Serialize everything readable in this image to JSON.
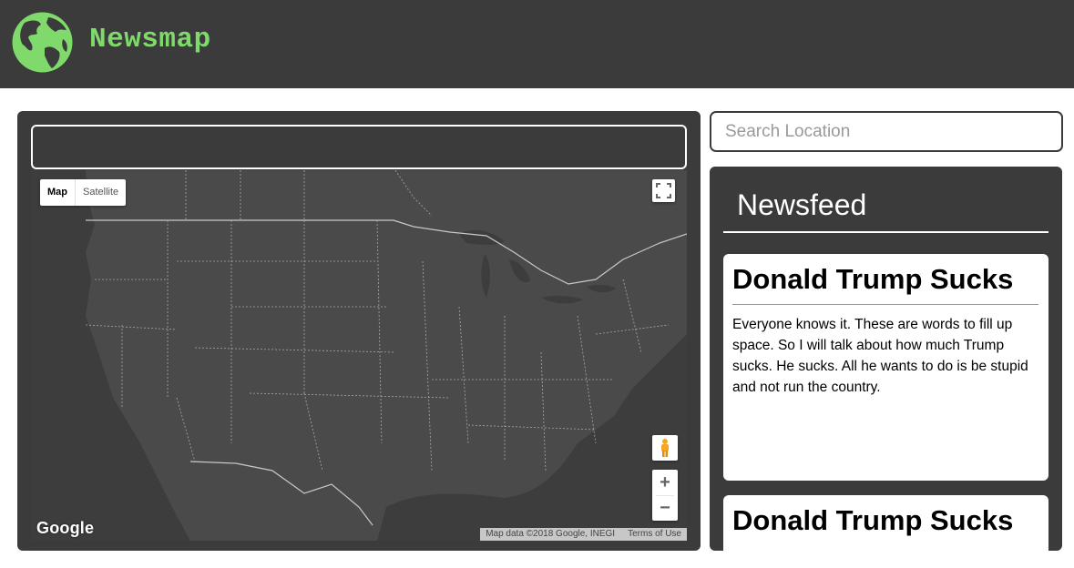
{
  "header": {
    "brand": "Newsmap",
    "logo_icon": "globe-icon",
    "brand_color": "#7fd96b",
    "bar_color": "#3b3b3b"
  },
  "map": {
    "title": "",
    "map_type_options": [
      "Map",
      "Satellite"
    ],
    "selected_map_type": "Map",
    "google_logo": "Google",
    "attribution": "Map data ©2018 Google, INEGI",
    "terms": "Terms of Use",
    "controls": {
      "fullscreen_icon": "fullscreen-icon",
      "pegman_icon": "pegman-icon",
      "zoom_in": "+",
      "zoom_out": "−"
    }
  },
  "search": {
    "placeholder": "Search Location",
    "value": ""
  },
  "feed": {
    "heading": "Newsfeed",
    "items": [
      {
        "title": "Donald Trump Sucks",
        "body": "Everyone knows it. These are words to fill up space. So I will talk about how much Trump sucks. He sucks. All he wants to do is be stupid and not run the country."
      },
      {
        "title": "Donald Trump Sucks",
        "body": ""
      }
    ]
  }
}
